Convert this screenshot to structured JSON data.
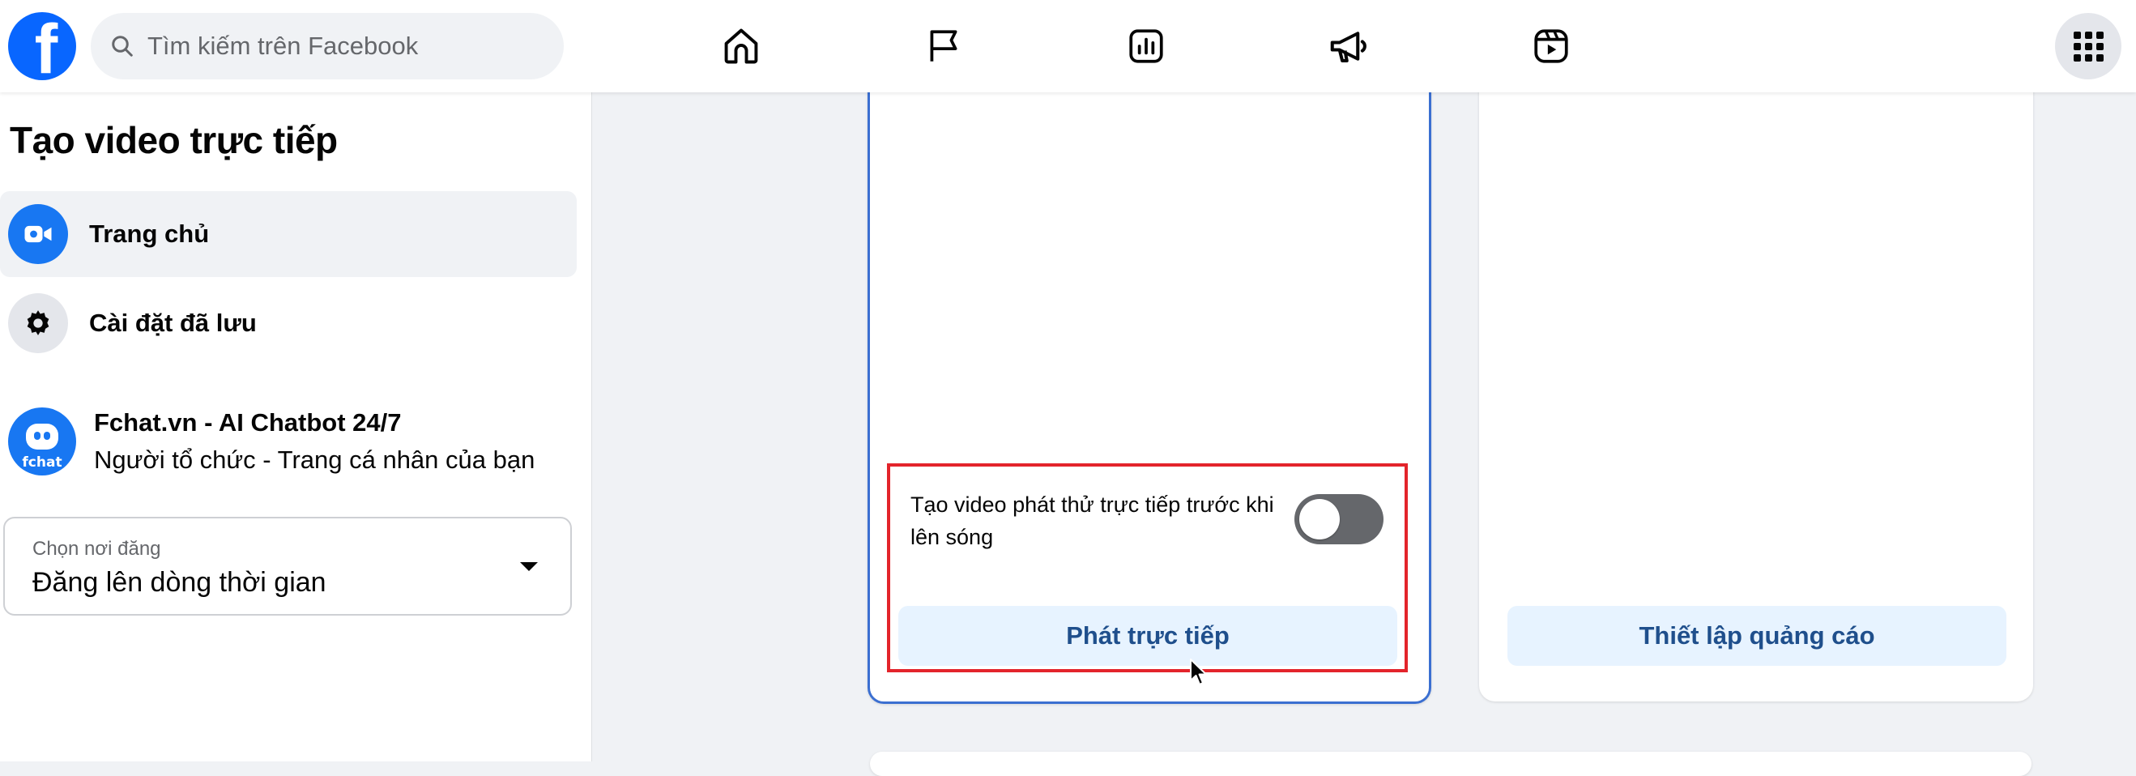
{
  "topbar": {
    "logo_letter": "f",
    "search_placeholder": "Tìm kiếm trên Facebook",
    "nav_icons": [
      "home-icon",
      "flag-icon",
      "insights-icon",
      "megaphone-icon",
      "reels-icon"
    ],
    "apps_icon": "menu-grid-icon"
  },
  "sidebar": {
    "title": "Tạo video trực tiếp",
    "items": [
      {
        "label": "Trang chủ",
        "icon": "live-video-icon",
        "active": true
      },
      {
        "label": "Cài đặt đã lưu",
        "icon": "gear-icon",
        "active": false
      }
    ],
    "profile": {
      "name": "Fchat.vn - AI Chatbot 24/7",
      "role": "Người tổ chức - Trang cá nhân của bạn",
      "avatar_text": "fchat"
    },
    "post_location": {
      "label": "Chọn nơi đăng",
      "value": "Đăng lên dòng thời gian"
    }
  },
  "main": {
    "left_card": {
      "toggle_label": "Tạo video phát thử trực tiếp trước khi lên sóng",
      "toggle_on": false,
      "button_label": "Phát trực tiếp"
    },
    "right_card": {
      "button_label": "Thiết lập quảng cáo"
    }
  },
  "colors": {
    "brand": "#0866ff",
    "highlight_border": "#e3242b",
    "button_bg": "#e7f3ff",
    "button_text": "#1f4f8c",
    "selected_card_border": "#3b6fd1"
  }
}
